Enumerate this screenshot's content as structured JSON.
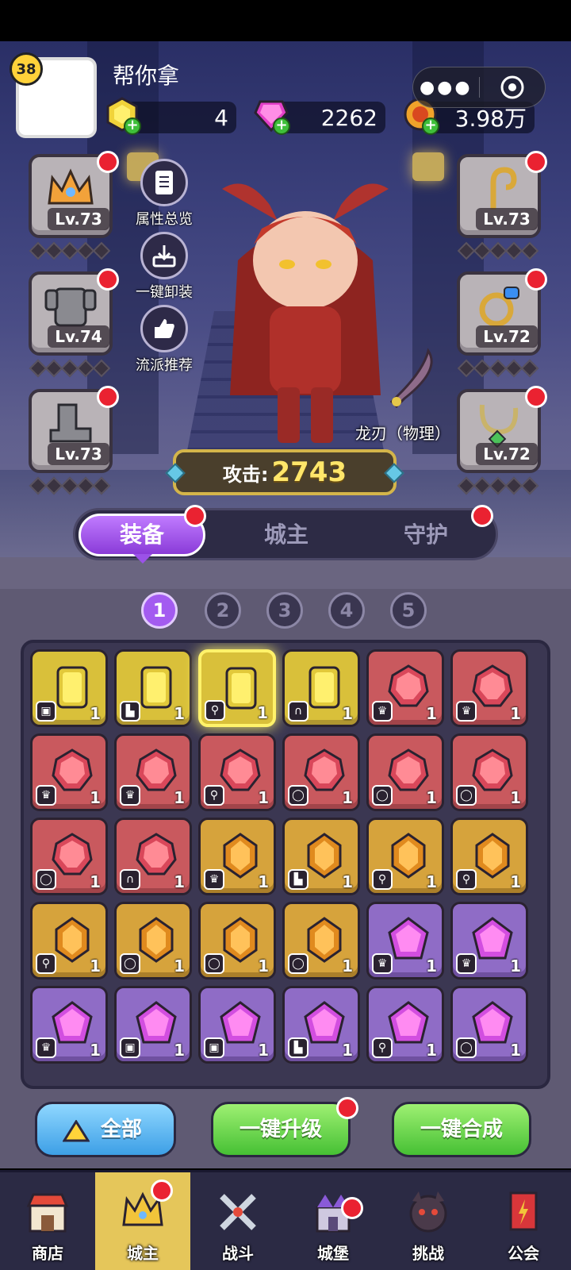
{
  "player": {
    "level": "38",
    "name": "帮你拿"
  },
  "resources": {
    "energy": "4",
    "gems": "2262",
    "coins": "3.98万"
  },
  "capsule": {
    "more_icon": "more-dots-icon",
    "close_icon": "target-circle-icon"
  },
  "slots": {
    "crown": {
      "level": "Lv.73"
    },
    "armor": {
      "level": "Lv.74"
    },
    "boots": {
      "level": "Lv.73"
    },
    "staff": {
      "level": "Lv.73"
    },
    "ring": {
      "level": "Lv.72"
    },
    "amulet": {
      "level": "Lv.72"
    }
  },
  "side_buttons": {
    "overview": "属性总览",
    "unequip": "一键卸装",
    "recommend": "流派推荐"
  },
  "weapon": {
    "label": "龙刃（物理）"
  },
  "attack": {
    "label": "攻击:",
    "value": "2743"
  },
  "tabs": [
    "装备",
    "城主",
    "守护"
  ],
  "pages": [
    "1",
    "2",
    "3",
    "4",
    "5"
  ],
  "inventory": [
    {
      "color": "yellow",
      "type": "armor-icon",
      "count": "1"
    },
    {
      "color": "yellow",
      "type": "boots-icon",
      "count": "1"
    },
    {
      "color": "yellow",
      "type": "staff-icon",
      "count": "1",
      "glow": true
    },
    {
      "color": "yellow",
      "type": "amulet-icon",
      "count": "1"
    },
    {
      "color": "red",
      "type": "crown-icon",
      "count": "1"
    },
    {
      "color": "red",
      "type": "crown-icon",
      "count": "1"
    },
    {
      "color": "red",
      "type": "crown-icon",
      "count": "1"
    },
    {
      "color": "red",
      "type": "crown-icon",
      "count": "1"
    },
    {
      "color": "red",
      "type": "staff-icon",
      "count": "1"
    },
    {
      "color": "red",
      "type": "ring-icon",
      "count": "1"
    },
    {
      "color": "red",
      "type": "ring-icon",
      "count": "1"
    },
    {
      "color": "red",
      "type": "ring-icon",
      "count": "1"
    },
    {
      "color": "red",
      "type": "ring-icon",
      "count": "1"
    },
    {
      "color": "red",
      "type": "amulet-icon",
      "count": "1"
    },
    {
      "color": "orange",
      "type": "crown-icon",
      "count": "1"
    },
    {
      "color": "orange",
      "type": "boots-icon",
      "count": "1"
    },
    {
      "color": "orange",
      "type": "staff-icon",
      "count": "1"
    },
    {
      "color": "orange",
      "type": "staff-icon",
      "count": "1"
    },
    {
      "color": "orange",
      "type": "staff-icon",
      "count": "1"
    },
    {
      "color": "orange",
      "type": "ring-icon",
      "count": "1"
    },
    {
      "color": "orange",
      "type": "ring-icon",
      "count": "1"
    },
    {
      "color": "orange",
      "type": "ring-icon",
      "count": "1"
    },
    {
      "color": "purple",
      "type": "crown-icon",
      "count": "1"
    },
    {
      "color": "purple",
      "type": "crown-icon",
      "count": "1"
    },
    {
      "color": "purple",
      "type": "crown-icon",
      "count": "1"
    },
    {
      "color": "purple",
      "type": "armor-icon",
      "count": "1"
    },
    {
      "color": "purple",
      "type": "armor-icon",
      "count": "1"
    },
    {
      "color": "purple",
      "type": "boots-icon",
      "count": "1"
    },
    {
      "color": "purple",
      "type": "staff-icon",
      "count": "1"
    },
    {
      "color": "purple",
      "type": "ring-icon",
      "count": "1"
    }
  ],
  "actions": {
    "all": "全部",
    "upgrade": "一键升级",
    "merge": "一键合成"
  },
  "nav": [
    {
      "label": "商店",
      "icon": "shop-icon"
    },
    {
      "label": "城主",
      "icon": "lord-icon"
    },
    {
      "label": "战斗",
      "icon": "battle-icon"
    },
    {
      "label": "城堡",
      "icon": "castle-icon"
    },
    {
      "label": "挑战",
      "icon": "challenge-icon"
    },
    {
      "label": "公会",
      "icon": "guild-icon"
    }
  ],
  "colors": {
    "accent_purple": "#a35bf0",
    "notify_red": "#ea2231",
    "active_nav": "#e5c65a"
  }
}
